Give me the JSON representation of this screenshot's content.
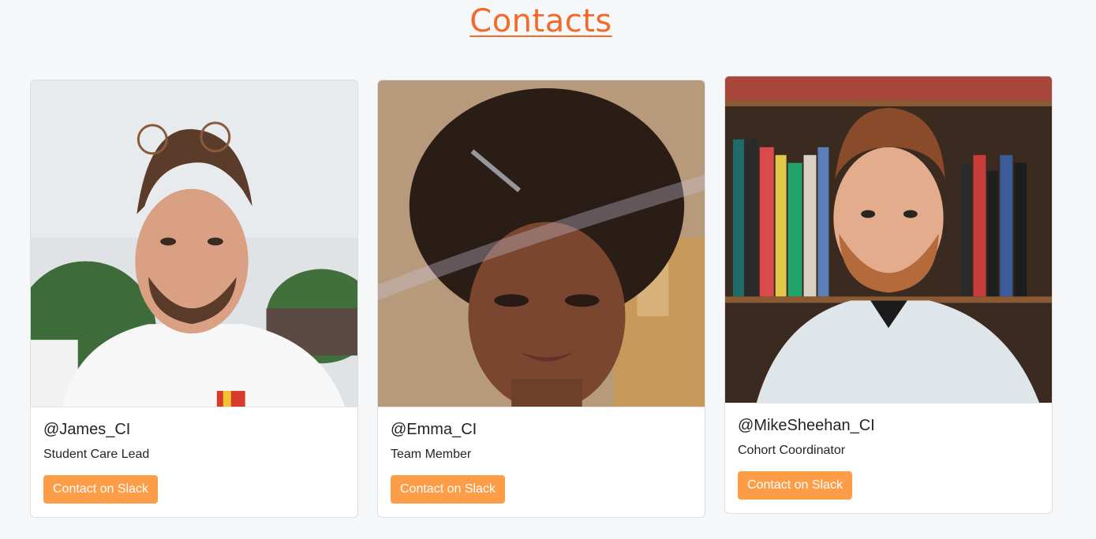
{
  "header": {
    "title": "Contacts"
  },
  "contacts": [
    {
      "handle": "@James_CI",
      "role": "Student Care Lead",
      "button_label": "Contact on Slack",
      "photo": "portrait-photo"
    },
    {
      "handle": "@Emma_CI",
      "role": "Team Member",
      "button_label": "Contact on Slack",
      "photo": "portrait-photo"
    },
    {
      "handle": "@MikeSheehan_CI",
      "role": "Cohort Coordinator",
      "button_label": "Contact on Slack",
      "photo": "portrait-photo"
    }
  ],
  "colors": {
    "title": "#f26b2a",
    "button": "#fd9d48",
    "background": "#f6f7f9"
  }
}
